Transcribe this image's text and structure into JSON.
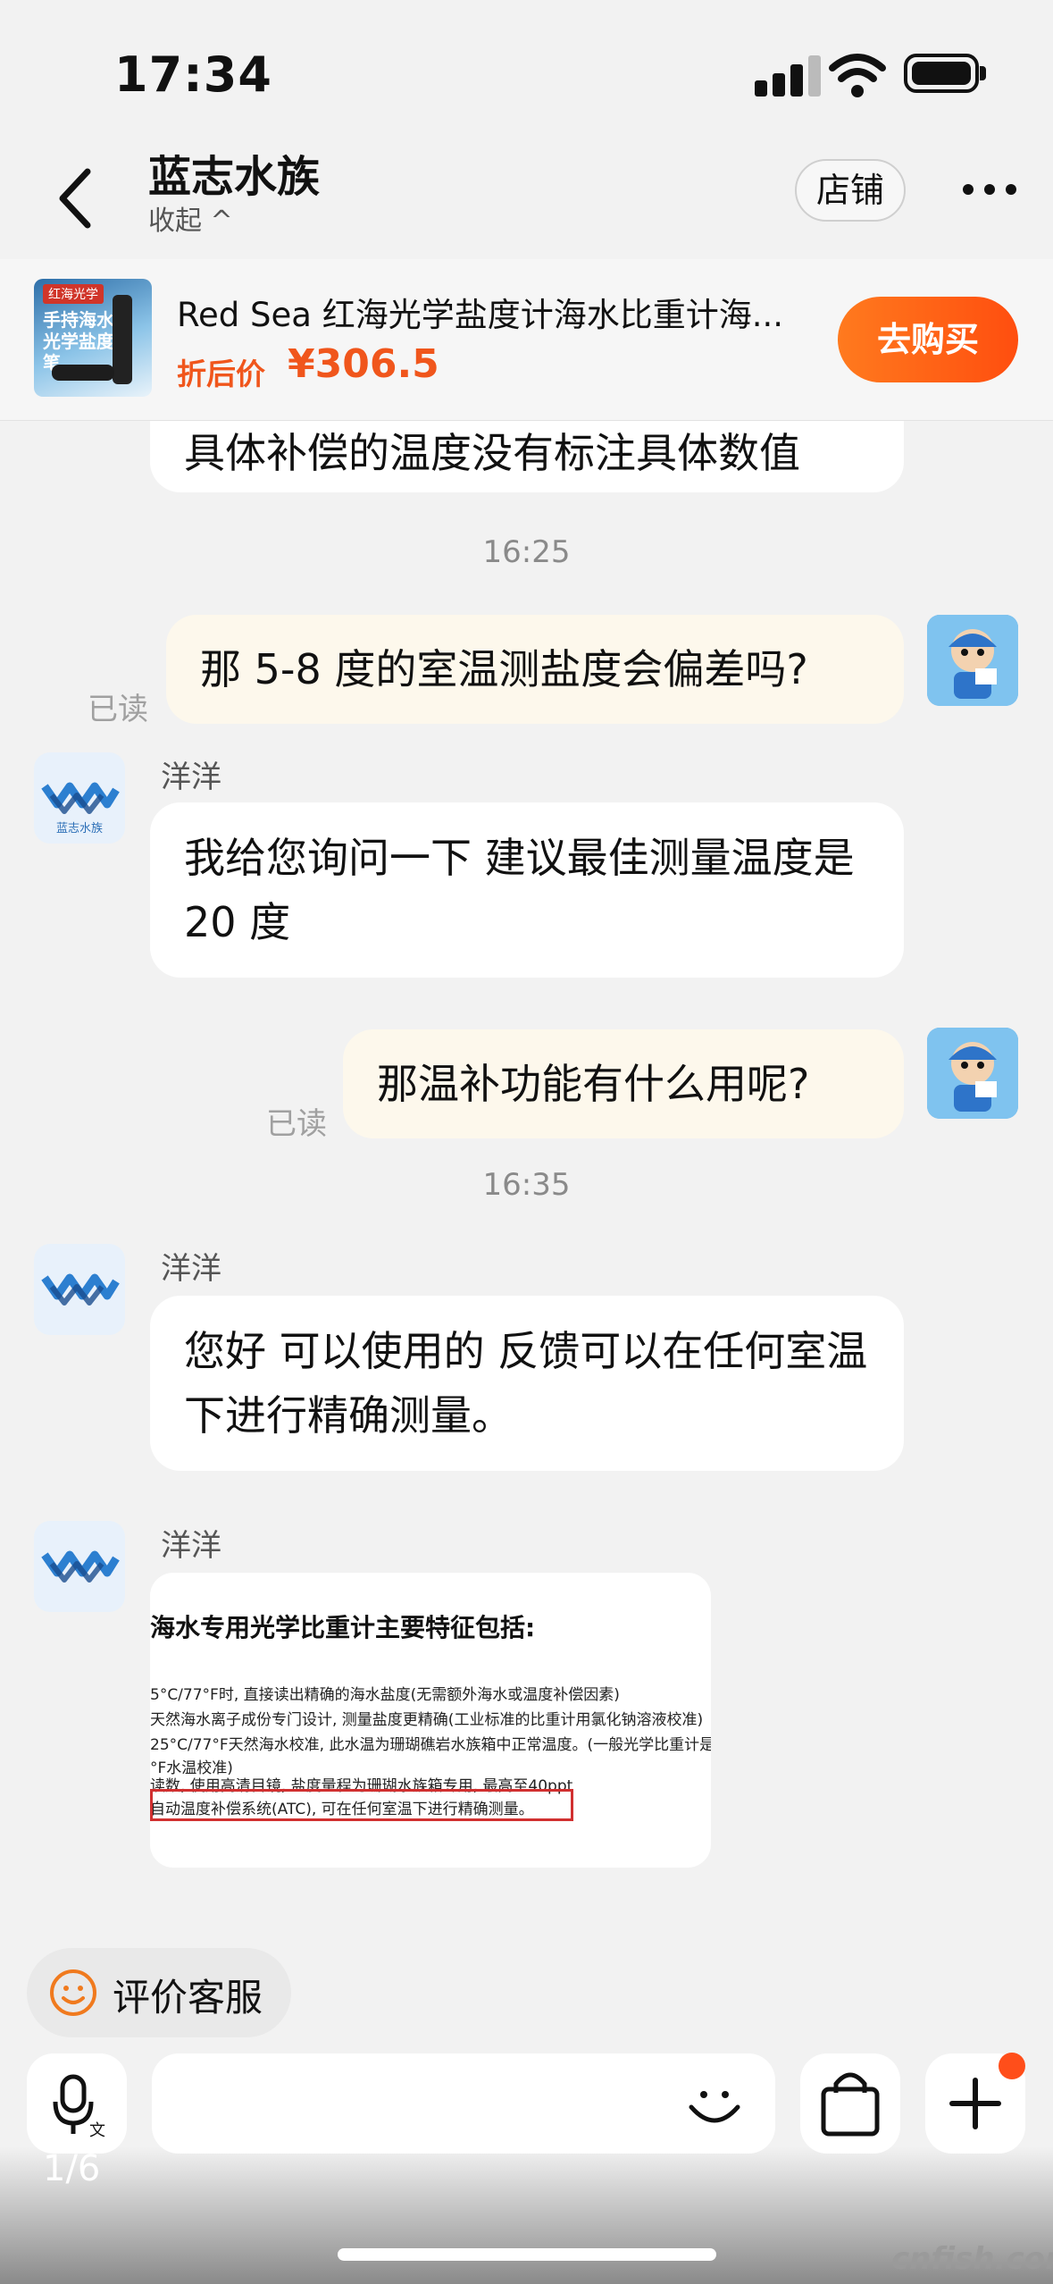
{
  "status_bar": {
    "time": "17:34"
  },
  "header": {
    "title": "蓝志水族",
    "collapse": "收起 ^",
    "shop_button": "店铺"
  },
  "product": {
    "title": "Red Sea 红海光学盐度计海水比重计海...",
    "price_label": "折后价",
    "price": "¥306.5",
    "buy_button": "去购买",
    "thumb_tag": "红海光学",
    "thumb_text": "手持海水光学盐度笔"
  },
  "messages": {
    "partial_text": "具体补偿的温度没有标注具体数值",
    "time1": "16:25",
    "me1": "那 5-8 度的室温测盐度会偏差吗?",
    "read1": "已读",
    "agent_name1": "洋洋",
    "agent1": "我给您询问一下  建议最佳测量温度是 20 度",
    "me2": "那温补功能有什么用呢?",
    "read2": "已读",
    "time2": "16:35",
    "agent_name2": "洋洋",
    "agent2": "您好 可以使用的 反馈可以在任何室温下进行精确测量。",
    "agent_name3": "洋洋",
    "image_msg": {
      "heading": "海水专用光学比重计主要特征包括:",
      "lines": [
        "5°C/77°F时, 直接读出精确的海水盐度(无需额外海水或温度补偿因素)",
        "天然海水离子成份专门设计, 测量盐度更精确(工业标准的比重计用氯化钠溶液校准)",
        "25°C/77°F天然海水校准, 此水温为珊瑚礁岩水族箱中正常温度。(一般光学比重计是",
        "°F水温校准)",
        "读数, 使用高清目镜, 盐度量程为珊瑚水族箱专用, 最高至40ppt",
        "自动温度补偿系统(ATC), 可在任何室温下进行精确测量。"
      ]
    }
  },
  "rating_button": "评价客服",
  "shop_logo_text": "蓝志水族",
  "page_indicator": "1/6",
  "watermark": "cnfish.com",
  "colors": {
    "accent": "#ff5a14",
    "bubble_me": "#fdf8ec",
    "bubble_other": "#ffffff",
    "background": "#f2f2f2"
  }
}
